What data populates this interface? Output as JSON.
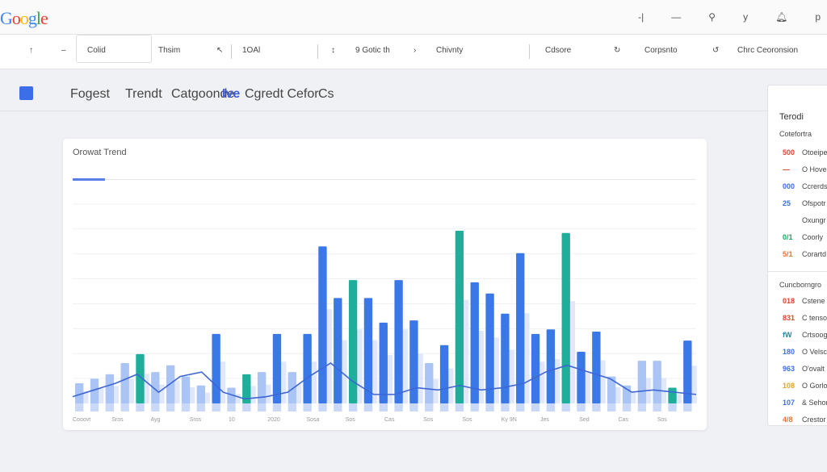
{
  "header": {
    "logo": "Google",
    "icons": [
      "minus-icon",
      "dash-icon",
      "pin-icon",
      "filter-icon",
      "bell-icon",
      "profile-icon"
    ]
  },
  "toolbar": {
    "items": [
      "Colid",
      "Thsim",
      "1OAl",
      "9 Gotic th",
      "Chivnty",
      "Cdsore",
      "Corpsnto",
      "Chrc Ceoronsion"
    ]
  },
  "subnav": {
    "items": [
      "Fogest",
      "Trendt",
      "Catgoonde",
      "Ive",
      "Cgredt Cefor",
      "Cs"
    ]
  },
  "chart_card": {
    "title": "Orowat Trend"
  },
  "chart_data": {
    "type": "bar",
    "title": "Orowat Trend",
    "ylim": [
      0,
      100
    ],
    "grid": true,
    "values": [
      9,
      11,
      13,
      18,
      22,
      14,
      17,
      12,
      8,
      31,
      7,
      13,
      14,
      31,
      14,
      31,
      70,
      47,
      55,
      47,
      36,
      55,
      37,
      18,
      26,
      77,
      54,
      49,
      40,
      67,
      31,
      33,
      76,
      23,
      32,
      12,
      8,
      19,
      19,
      7,
      28
    ],
    "line_series": [
      {
        "values": [
          3,
          6,
          9,
          13,
          5,
          12,
          14,
          5,
          2,
          3,
          5,
          12,
          18,
          10,
          4,
          4,
          7,
          6,
          8,
          6,
          7,
          9,
          14,
          17,
          14,
          11,
          5,
          6,
          5,
          4
        ]
      }
    ],
    "x_tick_labels": [
      "Cooovt",
      "Sros",
      "Ayg",
      "Sros",
      "10",
      "2020",
      "Sosa",
      "Sos",
      "Cas",
      "Sos",
      "Sos",
      "Ky 9N",
      "Jes",
      "Sed",
      "Cas",
      "Sos"
    ]
  },
  "right_panel": {
    "title": "Terodi",
    "section1": "Cotefortra",
    "rows1": [
      {
        "v": "500",
        "t": "Otoeipe",
        "c": "#d9482f"
      },
      {
        "v": "—",
        "t": "O Hove",
        "c": "#d9482f"
      },
      {
        "v": "000",
        "t": "Ccrerds",
        "c": "#3b6ee8"
      },
      {
        "v": "25",
        "t": "Ofspotr",
        "c": "#3b6ee8"
      },
      {
        "v": "",
        "t": "Oxungr",
        "c": "#1ea362"
      },
      {
        "v": "0/1",
        "t": "Coorly",
        "c": "#1ea362"
      },
      {
        "v": "5/1",
        "t": "Corartd",
        "c": "#e8732f"
      }
    ],
    "section2": "Cuncborngro",
    "rows2": [
      {
        "v": "018",
        "t": "Cstene",
        "c": "#d9482f"
      },
      {
        "v": "831",
        "t": "C tenso",
        "c": "#d9482f"
      },
      {
        "v": "fW",
        "t": "Crtsoog",
        "c": "#1e8aa3"
      },
      {
        "v": "180",
        "t": "O Velsce",
        "c": "#3b6ee8"
      },
      {
        "v": "963",
        "t": "O'ovalt",
        "c": "#3b6ee8"
      },
      {
        "v": "108",
        "t": "O Gorlo",
        "c": "#e8a32f"
      },
      {
        "v": "107",
        "t": "& Sehor",
        "c": "#3b6ee8"
      },
      {
        "v": "4/8",
        "t": "Crestor",
        "c": "#e8732f"
      }
    ]
  },
  "colors": {
    "primary_bar": "#3b78e7",
    "light_bar": "#a9c4f5",
    "teal": "#1fae9a",
    "line": "#3e66d4"
  }
}
